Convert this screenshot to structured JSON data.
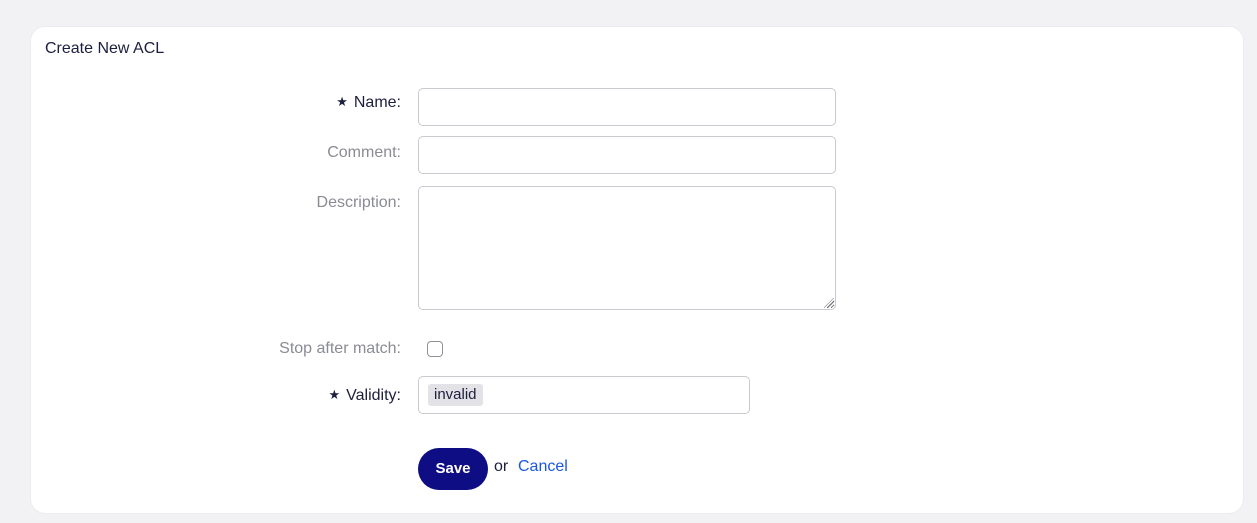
{
  "form": {
    "title": "Create New ACL",
    "required_marker": "★",
    "name": {
      "label": "Name:",
      "value": "",
      "placeholder": ""
    },
    "comment": {
      "label": "Comment:",
      "value": "",
      "placeholder": ""
    },
    "description": {
      "label": "Description:",
      "value": "",
      "placeholder": ""
    },
    "stop_after_match": {
      "label": "Stop after match:",
      "checked": false
    },
    "validity": {
      "label": "Validity:",
      "selected": "invalid"
    },
    "actions": {
      "save_label": "Save",
      "or_text": "or",
      "cancel_label": "Cancel"
    }
  },
  "colors": {
    "primary_button": "#0f0d84",
    "link": "#1a57e0",
    "text_dark": "#1c1e3d",
    "text_muted": "#8a8b93"
  }
}
